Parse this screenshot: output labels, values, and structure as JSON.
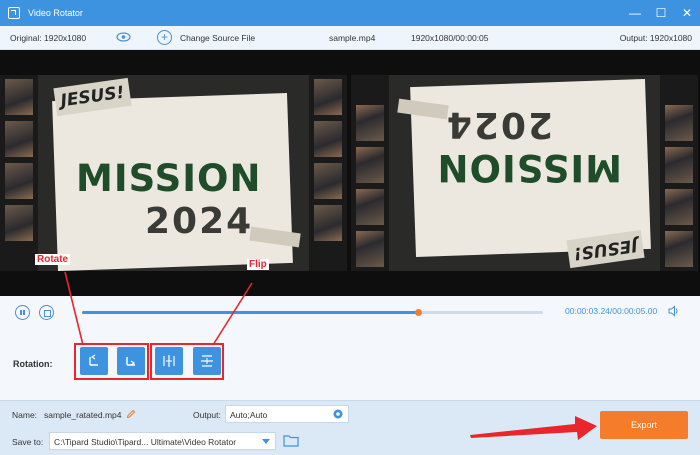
{
  "window": {
    "title": "Video Rotator",
    "controls": [
      "minimize-icon",
      "maximize-icon",
      "close-icon"
    ]
  },
  "infobar": {
    "original": "Original: 1920x1080",
    "change_source": "Change Source File",
    "file_name": "sample.mp4",
    "file_info": "1920x1080/00:00:05",
    "output": "Output: 1920x1080"
  },
  "preview": {
    "poster_title": "MISSION",
    "poster_year": "2024",
    "poster_tag": "JESUS!"
  },
  "annotations": {
    "rotate": "Rotate",
    "flip": "Flip",
    "accent_color": "#e8262b"
  },
  "playback": {
    "time": "00:00:03.24/00:00:05.00",
    "progress": 0.73
  },
  "rotation": {
    "label": "Rotation:",
    "buttons": [
      "rotate-left-icon",
      "rotate-right-icon",
      "flip-horizontal-icon",
      "flip-vertical-icon"
    ]
  },
  "output_panel": {
    "name_label": "Name:",
    "name_value": "sample_ratated.mp4",
    "output_label": "Output:",
    "output_value": "Auto;Auto",
    "save_label": "Save to:",
    "save_path": "C:\\Tipard Studio\\Tipard... Ultimate\\Video Rotator",
    "export_label": "Export"
  },
  "colors": {
    "primary": "#3d93e0",
    "export": "#f47c2a",
    "title_bar": "#3d93e0"
  }
}
